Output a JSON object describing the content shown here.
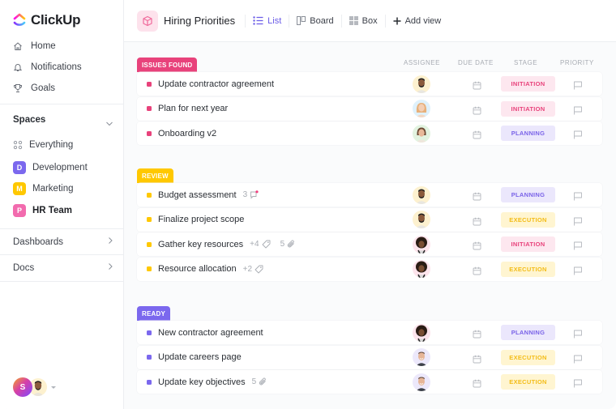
{
  "app": {
    "name": "ClickUp"
  },
  "sidebar": {
    "nav": [
      {
        "label": "Home",
        "icon": "home-icon"
      },
      {
        "label": "Notifications",
        "icon": "bell-icon"
      },
      {
        "label": "Goals",
        "icon": "trophy-icon"
      }
    ],
    "spaces_title": "Spaces",
    "everything_label": "Everything",
    "spaces": [
      {
        "letter": "D",
        "label": "Development",
        "color": "#7b68ee",
        "bold": false
      },
      {
        "letter": "M",
        "label": "Marketing",
        "color": "#ffc800",
        "bold": false
      },
      {
        "letter": "P",
        "label": "HR Team",
        "color": "#f26bae",
        "bold": true
      }
    ],
    "dashboards_label": "Dashboards",
    "docs_label": "Docs",
    "user_initial": "S"
  },
  "header": {
    "title": "Hiring Priorities",
    "views": [
      {
        "label": "List",
        "icon": "list-icon",
        "active": true
      },
      {
        "label": "Board",
        "icon": "board-icon",
        "active": false
      },
      {
        "label": "Box",
        "icon": "box-icon",
        "active": false
      }
    ],
    "add_view_label": "Add view"
  },
  "columns": {
    "assignee": "ASSIGNEE",
    "due_date": "DUE DATE",
    "stage": "STAGE",
    "priority": "PRIORITY"
  },
  "groups": [
    {
      "label": "ISSUES FOUND",
      "color": "#e8427b",
      "tasks": [
        {
          "name": "Update contractor agreement",
          "assignee": "man-beard",
          "stage": "INITIATION",
          "stage_key": "initiation",
          "meta": []
        },
        {
          "name": "Plan for next year",
          "assignee": "woman-blonde",
          "stage": "INITIATION",
          "stage_key": "initiation",
          "meta": []
        },
        {
          "name": "Onboarding v2",
          "assignee": "woman-curly",
          "stage": "PLANNING",
          "stage_key": "planning",
          "meta": []
        }
      ]
    },
    {
      "label": "REVIEW",
      "color": "#ffc800",
      "tasks": [
        {
          "name": "Budget assessment",
          "assignee": "man-beard",
          "stage": "PLANNING",
          "stage_key": "planning",
          "meta": [
            {
              "count": "3",
              "icon": "comment-icon"
            }
          ]
        },
        {
          "name": "Finalize project scope",
          "assignee": "man-beard",
          "stage": "EXECUTION",
          "stage_key": "execution",
          "meta": []
        },
        {
          "name": "Gather key resources",
          "assignee": "man-afro",
          "stage": "INITIATION",
          "stage_key": "initiation",
          "meta": [
            {
              "count": "+4",
              "icon": "tag-icon"
            },
            {
              "count": "5",
              "icon": "attachment-icon"
            }
          ]
        },
        {
          "name": "Resource allocation",
          "assignee": "man-afro",
          "stage": "EXECUTION",
          "stage_key": "execution",
          "meta": [
            {
              "count": "+2",
              "icon": "tag-icon"
            }
          ]
        }
      ]
    },
    {
      "label": "READY",
      "color": "#7b68ee",
      "tasks": [
        {
          "name": "New contractor agreement",
          "assignee": "man-afro",
          "stage": "PLANNING",
          "stage_key": "planning",
          "meta": []
        },
        {
          "name": "Update careers page",
          "assignee": "man-smile",
          "stage": "EXECUTION",
          "stage_key": "execution",
          "meta": []
        },
        {
          "name": "Update key objectives",
          "assignee": "man-smile",
          "stage": "EXECUTION",
          "stage_key": "execution",
          "meta": [
            {
              "count": "5",
              "icon": "attachment-icon"
            }
          ]
        }
      ]
    }
  ]
}
